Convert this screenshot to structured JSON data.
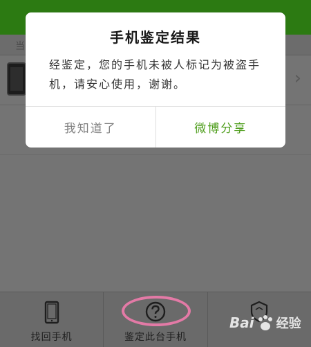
{
  "app": {
    "subbar_text": "当",
    "bottom_nav": [
      {
        "label": "找回手机",
        "icon": "tablet-icon"
      },
      {
        "label": "鉴定此台手机",
        "icon": "question-circle-icon"
      },
      {
        "label": "",
        "icon": "shield-icon"
      }
    ]
  },
  "dialog": {
    "title": "手机鉴定结果",
    "message": "经鉴定，您的手机未被人标记为被盗手机，请安心使用，谢谢。",
    "cancel_label": "我知道了",
    "share_label": "微博分享"
  },
  "watermark": {
    "bai": "Bai",
    "text": "经验"
  },
  "colors": {
    "accent_green": "#4f9e1d",
    "topbar_green": "#2c7a12",
    "annotation_pink": "#e37aa6"
  }
}
